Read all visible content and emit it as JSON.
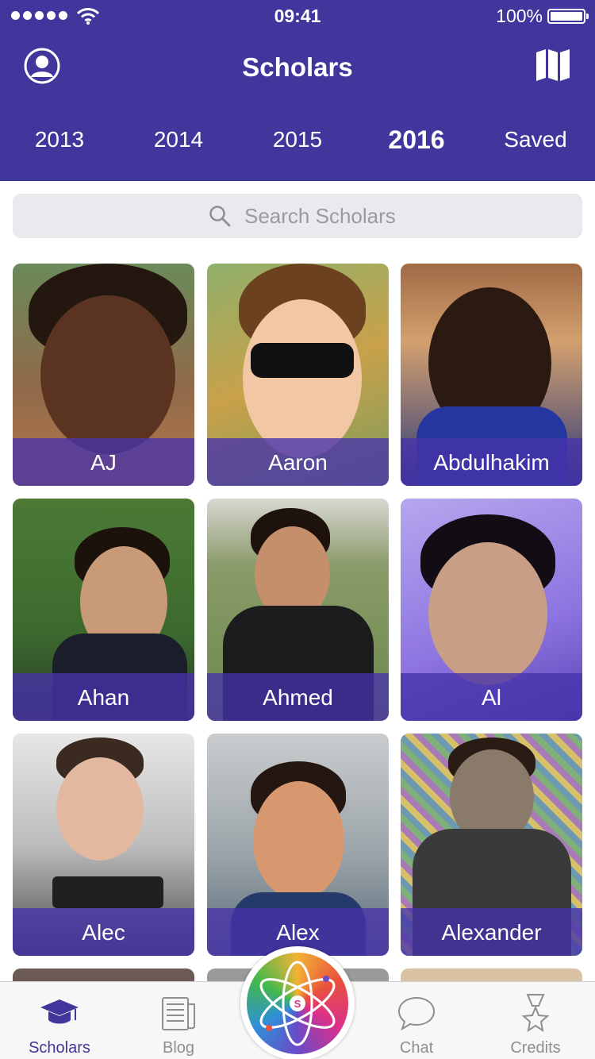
{
  "status_bar": {
    "time": "09:41",
    "battery_percent": "100%"
  },
  "nav": {
    "title": "Scholars",
    "left_icon": "profile-icon",
    "right_icon": "map-icon"
  },
  "year_tabs": [
    {
      "label": "2013",
      "active": false
    },
    {
      "label": "2014",
      "active": false
    },
    {
      "label": "2015",
      "active": false
    },
    {
      "label": "2016",
      "active": true
    },
    {
      "label": "Saved",
      "active": false
    }
  ],
  "search": {
    "placeholder": "Search Scholars"
  },
  "scholars": [
    {
      "name": "AJ"
    },
    {
      "name": "Aaron"
    },
    {
      "name": "Abdulhakim"
    },
    {
      "name": "Ahan"
    },
    {
      "name": "Ahmed"
    },
    {
      "name": "Al"
    },
    {
      "name": "Alec"
    },
    {
      "name": "Alex"
    },
    {
      "name": "Alexander"
    }
  ],
  "tab_bar": {
    "items": [
      {
        "label": "Scholars",
        "icon": "graduation-cap-icon",
        "active": true
      },
      {
        "label": "Blog",
        "icon": "newspaper-icon",
        "active": false
      },
      {
        "label": "",
        "icon": "atom-icon",
        "active": false
      },
      {
        "label": "Chat",
        "icon": "chat-bubble-icon",
        "active": false
      },
      {
        "label": "Credits",
        "icon": "star-award-icon",
        "active": false
      }
    ]
  },
  "colors": {
    "brand": "#41369b",
    "inactive_tab": "#8e8e93",
    "search_bg": "#e9e9ee"
  }
}
